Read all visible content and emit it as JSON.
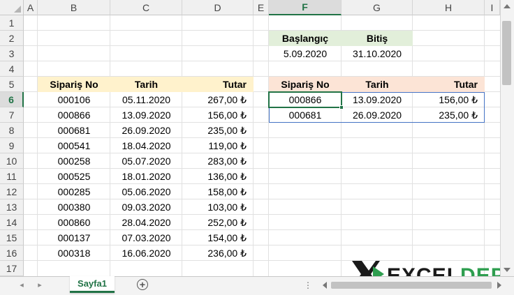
{
  "columns": [
    "A",
    "B",
    "C",
    "D",
    "E",
    "F",
    "G",
    "H",
    "I"
  ],
  "rows": [
    "1",
    "2",
    "3",
    "4",
    "5",
    "6",
    "7",
    "8",
    "9",
    "10",
    "11",
    "12",
    "13",
    "14",
    "15",
    "16",
    "17"
  ],
  "left_table": {
    "headers": [
      "Sipariş No",
      "Tarih",
      "Tutar"
    ],
    "rows": [
      [
        "000106",
        "05.11.2020",
        "267,00 ₺"
      ],
      [
        "000866",
        "13.09.2020",
        "156,00 ₺"
      ],
      [
        "000681",
        "26.09.2020",
        "235,00 ₺"
      ],
      [
        "000541",
        "18.04.2020",
        "119,00 ₺"
      ],
      [
        "000258",
        "05.07.2020",
        "283,00 ₺"
      ],
      [
        "000525",
        "18.01.2020",
        "136,00 ₺"
      ],
      [
        "000285",
        "05.06.2020",
        "158,00 ₺"
      ],
      [
        "000380",
        "09.03.2020",
        "103,00 ₺"
      ],
      [
        "000860",
        "28.04.2020",
        "252,00 ₺"
      ],
      [
        "000137",
        "07.03.2020",
        "154,00 ₺"
      ],
      [
        "000318",
        "16.06.2020",
        "236,00 ₺"
      ]
    ]
  },
  "criteria": {
    "headers": [
      "Başlangıç",
      "Bitiş"
    ],
    "values": [
      "5.09.2020",
      "31.10.2020"
    ]
  },
  "result_table": {
    "headers": [
      "Sipariş No",
      "Tarih",
      "Tutar"
    ],
    "rows": [
      [
        "000866",
        "13.09.2020",
        "156,00 ₺"
      ],
      [
        "000681",
        "26.09.2020",
        "235,00 ₺"
      ]
    ]
  },
  "sheet_tab": "Sayfa1",
  "nav": {
    "prev": "◂",
    "next": "▸",
    "add": "+",
    "more": "⋮"
  },
  "logo": {
    "mark": "X",
    "word1": "EXCEL",
    "word2": "DEPO"
  },
  "colors": {
    "left_header_bg": "#fff2cc",
    "criteria_header_bg": "#e2efda",
    "result_header_bg": "#fce4d6",
    "accent": "#217346",
    "result_border": "#4472c4"
  }
}
